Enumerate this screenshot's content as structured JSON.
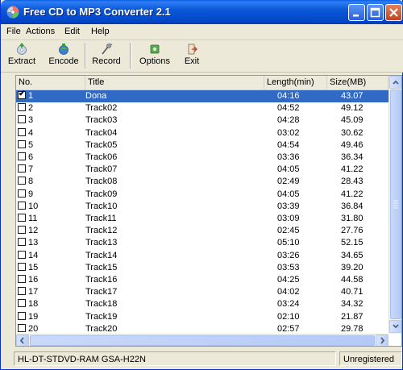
{
  "window": {
    "title": "Free CD to MP3 Converter 2.1"
  },
  "menu": {
    "items": [
      "File",
      "Actions",
      "Edit",
      "Help"
    ]
  },
  "toolbar": {
    "buttons": [
      {
        "label": "Extract",
        "icon": "extract-icon"
      },
      {
        "label": "Encode",
        "icon": "encode-icon"
      },
      {
        "label": "Record",
        "icon": "record-icon"
      },
      {
        "label": "Options",
        "icon": "options-icon"
      },
      {
        "label": "Exit",
        "icon": "exit-icon"
      }
    ]
  },
  "list": {
    "columns": [
      "No.",
      "Title",
      "Length(min)",
      "Size(MB)"
    ],
    "rows": [
      {
        "no": "1",
        "title": "Dona",
        "length": "04:16",
        "size": "43.07",
        "checked": true,
        "selected": true
      },
      {
        "no": "2",
        "title": "Track02",
        "length": "04:52",
        "size": "49.12",
        "checked": false
      },
      {
        "no": "3",
        "title": "Track03",
        "length": "04:28",
        "size": "45.09",
        "checked": false
      },
      {
        "no": "4",
        "title": "Track04",
        "length": "03:02",
        "size": "30.62",
        "checked": false
      },
      {
        "no": "5",
        "title": "Track05",
        "length": "04:54",
        "size": "49.46",
        "checked": false
      },
      {
        "no": "6",
        "title": "Track06",
        "length": "03:36",
        "size": "36.34",
        "checked": false
      },
      {
        "no": "7",
        "title": "Track07",
        "length": "04:05",
        "size": "41.22",
        "checked": false
      },
      {
        "no": "8",
        "title": "Track08",
        "length": "02:49",
        "size": "28.43",
        "checked": false
      },
      {
        "no": "9",
        "title": "Track09",
        "length": "04:05",
        "size": "41.22",
        "checked": false
      },
      {
        "no": "10",
        "title": "Track10",
        "length": "03:39",
        "size": "36.84",
        "checked": false
      },
      {
        "no": "11",
        "title": "Track11",
        "length": "03:09",
        "size": "31.80",
        "checked": false
      },
      {
        "no": "12",
        "title": "Track12",
        "length": "02:45",
        "size": "27.76",
        "checked": false
      },
      {
        "no": "13",
        "title": "Track13",
        "length": "05:10",
        "size": "52.15",
        "checked": false
      },
      {
        "no": "14",
        "title": "Track14",
        "length": "03:26",
        "size": "34.65",
        "checked": false
      },
      {
        "no": "15",
        "title": "Track15",
        "length": "03:53",
        "size": "39.20",
        "checked": false
      },
      {
        "no": "16",
        "title": "Track16",
        "length": "04:25",
        "size": "44.58",
        "checked": false
      },
      {
        "no": "17",
        "title": "Track17",
        "length": "04:02",
        "size": "40.71",
        "checked": false
      },
      {
        "no": "18",
        "title": "Track18",
        "length": "03:24",
        "size": "34.32",
        "checked": false
      },
      {
        "no": "19",
        "title": "Track19",
        "length": "02:10",
        "size": "21.87",
        "checked": false
      },
      {
        "no": "20",
        "title": "Track20",
        "length": "02:57",
        "size": "29.78",
        "checked": false
      }
    ]
  },
  "status": {
    "drive": "HL-DT-STDVD-RAM GSA-H22N",
    "registration": "Unregistered"
  },
  "colors": {
    "titlebar": "#0a58d8",
    "selection": "#316ac5",
    "face": "#ece9d8"
  }
}
